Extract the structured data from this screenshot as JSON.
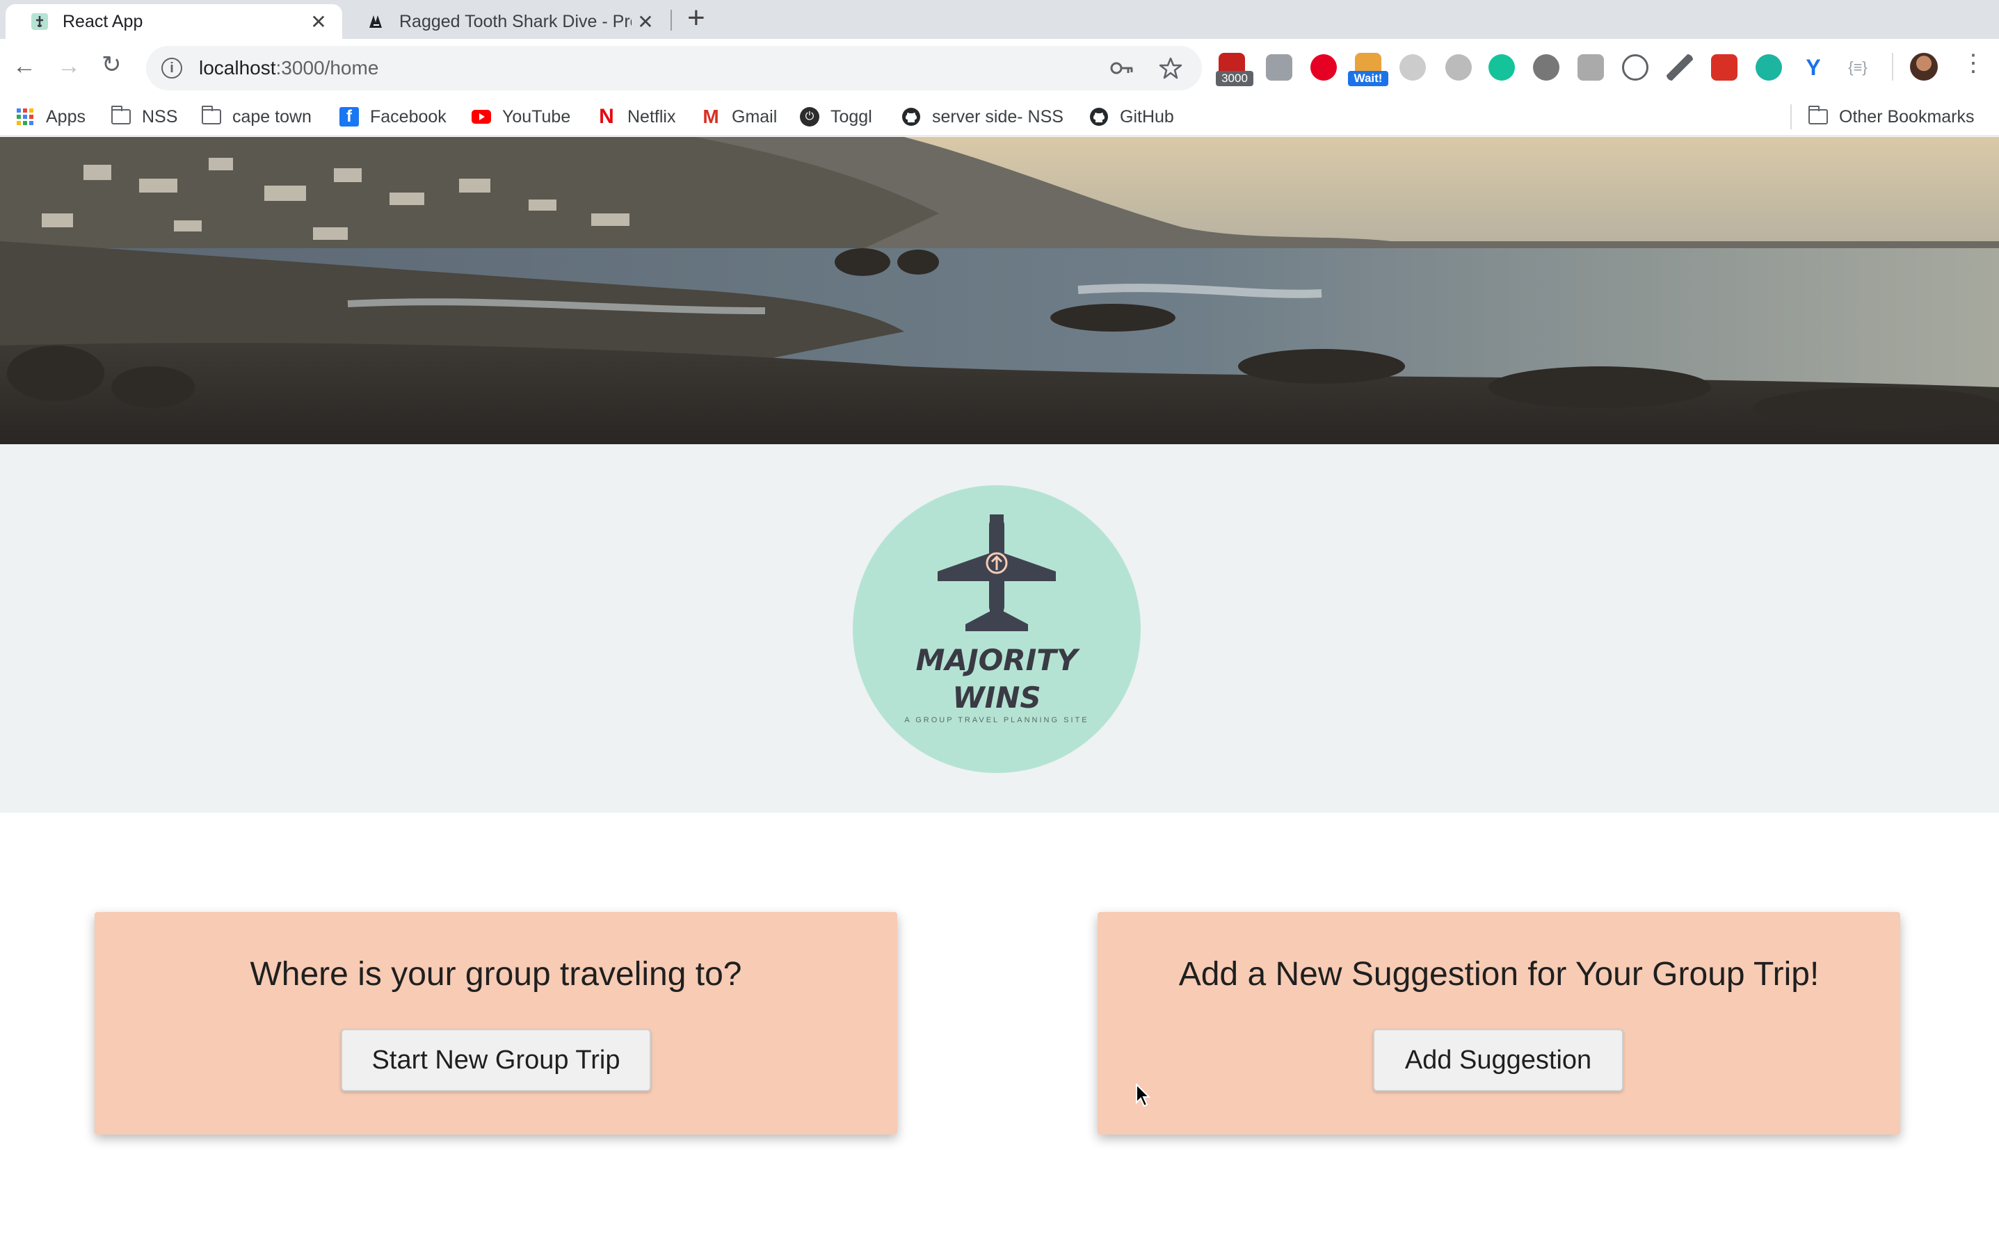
{
  "browser": {
    "tabs": [
      {
        "title": "React App",
        "icon": "react-favicon-icon",
        "active": true
      },
      {
        "title": "Ragged Tooth Shark Dive - Pro",
        "icon": "shark-favicon-icon",
        "active": false
      }
    ],
    "new_tab_icon": "plus-icon",
    "address_bar": {
      "host": "localhost",
      "path": ":3000/home",
      "icon": "info-icon"
    },
    "toolbar_icons": [
      "key-icon",
      "star-icon",
      "profile-avatar-icon",
      "menu-kebab-icon"
    ],
    "extensions": [
      {
        "icon": "extension-blocker-icon",
        "badge": "3000",
        "color": "#c5221f"
      },
      {
        "icon": "extension-grey-icon",
        "color": "#9aa0a6"
      },
      {
        "icon": "pinterest-icon",
        "color": "#e60023"
      },
      {
        "icon": "extension-wait-icon",
        "badge": "Wait!",
        "color": "#e8a33c"
      },
      {
        "icon": "extension-vimium-icon",
        "color": "#aaaaaa"
      },
      {
        "icon": "extension-circle-icon",
        "color": "#bbbbbb"
      },
      {
        "icon": "grammarly-icon",
        "color": "#15c39a"
      },
      {
        "icon": "extension-eye-icon",
        "color": "#777777"
      },
      {
        "icon": "extension-grid-icon",
        "color": "#aaaaaa"
      },
      {
        "icon": "extension-chat-icon",
        "color": "#5f6368"
      },
      {
        "icon": "eyedropper-icon",
        "color": "#5f6368"
      },
      {
        "icon": "extension-red-icon",
        "color": "#d93025"
      },
      {
        "icon": "extension-teal-icon",
        "color": "#1bb5a0"
      },
      {
        "icon": "extension-y-icon",
        "color": "#1a73e8"
      },
      {
        "icon": "extension-brackets-icon",
        "color": "#9aa0a6"
      }
    ],
    "bookmarks": [
      {
        "label": "Apps",
        "icon": "apps-grid-icon"
      },
      {
        "label": "NSS",
        "icon": "folder-icon"
      },
      {
        "label": "cape town",
        "icon": "folder-icon"
      },
      {
        "label": "Facebook",
        "icon": "facebook-icon"
      },
      {
        "label": "YouTube",
        "icon": "youtube-icon"
      },
      {
        "label": "Netflix",
        "icon": "netflix-icon"
      },
      {
        "label": "Gmail",
        "icon": "gmail-icon"
      },
      {
        "label": "Toggl",
        "icon": "toggl-icon"
      },
      {
        "label": "server side- NSS",
        "icon": "github-icon"
      },
      {
        "label": "GitHub",
        "icon": "github-icon"
      }
    ],
    "other_bookmarks": "Other Bookmarks"
  },
  "page": {
    "hero_image": "coastal-rocks-photo",
    "logo": {
      "line1": "MAJORITY",
      "line2": "WINS",
      "tagline": "A GROUP TRAVEL PLANNING SITE",
      "icon": "airplane-icon",
      "circle_color": "#b5e3d3"
    },
    "cards": [
      {
        "heading": "Where is your group traveling to?",
        "button": "Start New Group Trip"
      },
      {
        "heading": "Add a New Suggestion for Your Group Trip!",
        "button": "Add Suggestion"
      }
    ],
    "colors": {
      "card_bg": "#f7cbb4",
      "band_bg": "#eef2f2"
    }
  }
}
